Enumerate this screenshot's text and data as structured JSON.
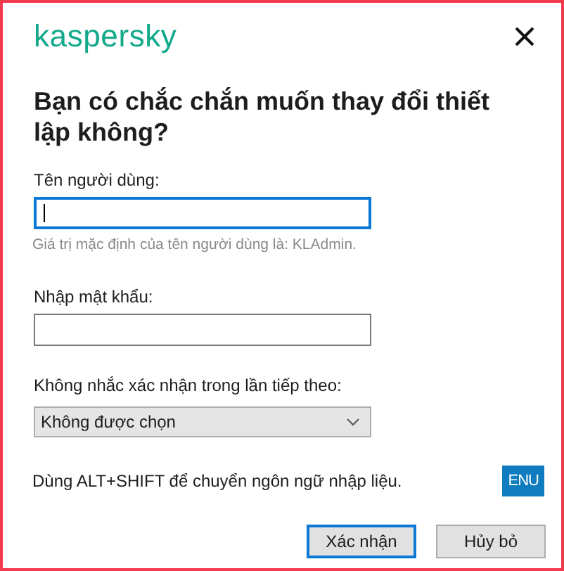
{
  "logo": "kaspersky",
  "title": "Bạn có chắc chắn muốn thay đổi thiết lập không?",
  "fields": [
    {
      "kind": "text",
      "label": "Tên người dùng:",
      "focused": true,
      "hint": "Giá trị mặc định của tên người dùng là: KLAdmin."
    },
    {
      "kind": "password",
      "label": "Nhập mật khẩu:",
      "focused": false
    },
    {
      "kind": "dropdown",
      "label": "Không nhắc xác nhận trong lần tiếp theo:",
      "value": "Không được chọn",
      "focused": false
    }
  ],
  "keyboard_hint": "Dùng ALT+SHIFT để chuyển ngôn ngữ nhập liệu.",
  "language_badge": "ENU",
  "buttons": [
    {
      "label": "Xác nhận",
      "focused": true
    },
    {
      "label": "Hủy bỏ",
      "focused": false
    }
  ]
}
